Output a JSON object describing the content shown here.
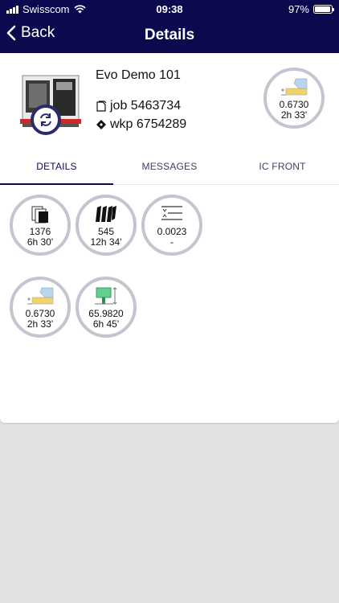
{
  "status_bar": {
    "carrier": "Swisscom",
    "time": "09:38",
    "battery": "97%",
    "battery_level": 0.97
  },
  "nav": {
    "back_label": "Back",
    "title": "Details"
  },
  "machine": {
    "name": "Evo Demo 101",
    "job_label": "job 5463734",
    "wkp_label": "wkp 6754289"
  },
  "header_gauge": {
    "value": "0.6730",
    "time": "2h 33'"
  },
  "tabs": [
    {
      "label": "DETAILS",
      "active": true
    },
    {
      "label": "MESSAGES",
      "active": false
    },
    {
      "label": "IC FRONT",
      "active": false
    }
  ],
  "gauges": [
    {
      "icon": "documents-icon",
      "value": "1376",
      "time": "6h 30'"
    },
    {
      "icon": "parts-icon",
      "value": "545",
      "time": "12h 34'"
    },
    {
      "icon": "tolerance-icon",
      "value": "0.0023",
      "time": "-"
    },
    {
      "icon": "tool-wear-icon",
      "value": "0.6730",
      "time": "2h 33'"
    },
    {
      "icon": "measurement-icon",
      "value": "65.9820",
      "time": "6h 45'"
    }
  ],
  "colors": {
    "nav_background": "#0c0a4e",
    "gauge_ring": "#c6c4d1",
    "page_background": "#e2e2e2"
  }
}
